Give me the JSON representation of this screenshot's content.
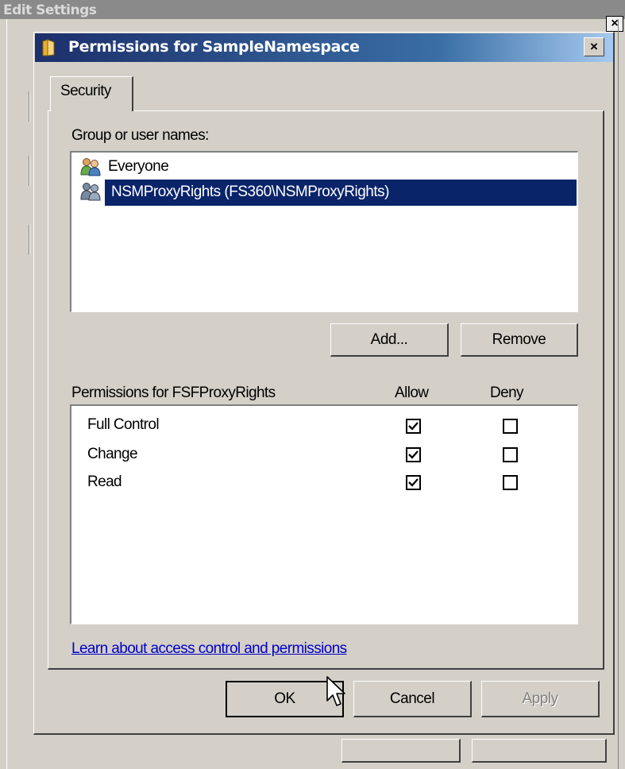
{
  "background_dialog": {
    "title": "Edit Settings"
  },
  "dialog": {
    "title": "Permissions for SampleNamespace",
    "close_label": "×",
    "tab_label": "Security",
    "group_label": "Group or user names:",
    "users": [
      {
        "name": "Everyone",
        "icon": "user-group-icon",
        "selected": false
      },
      {
        "name": "NSMProxyRights (FS360\\NSMProxyRights)",
        "icon": "user-group-icon",
        "selected": true
      }
    ],
    "add_button": "Add...",
    "remove_button": "Remove",
    "permissions_header": "Permissions for FSFProxyRights",
    "allow_header": "Allow",
    "deny_header": "Deny",
    "permissions": [
      {
        "name": "Full Control",
        "allow": true,
        "deny": false
      },
      {
        "name": "Change",
        "allow": true,
        "deny": false
      },
      {
        "name": "Read",
        "allow": true,
        "deny": false
      }
    ],
    "learn_link": "Learn about access control and permissions",
    "ok_button": "OK",
    "cancel_button": "Cancel",
    "apply_button": "Apply"
  },
  "colors": {
    "selection": "#0a246a",
    "title_gradient_start": "#1c2f6b",
    "link": "#0000cc"
  }
}
